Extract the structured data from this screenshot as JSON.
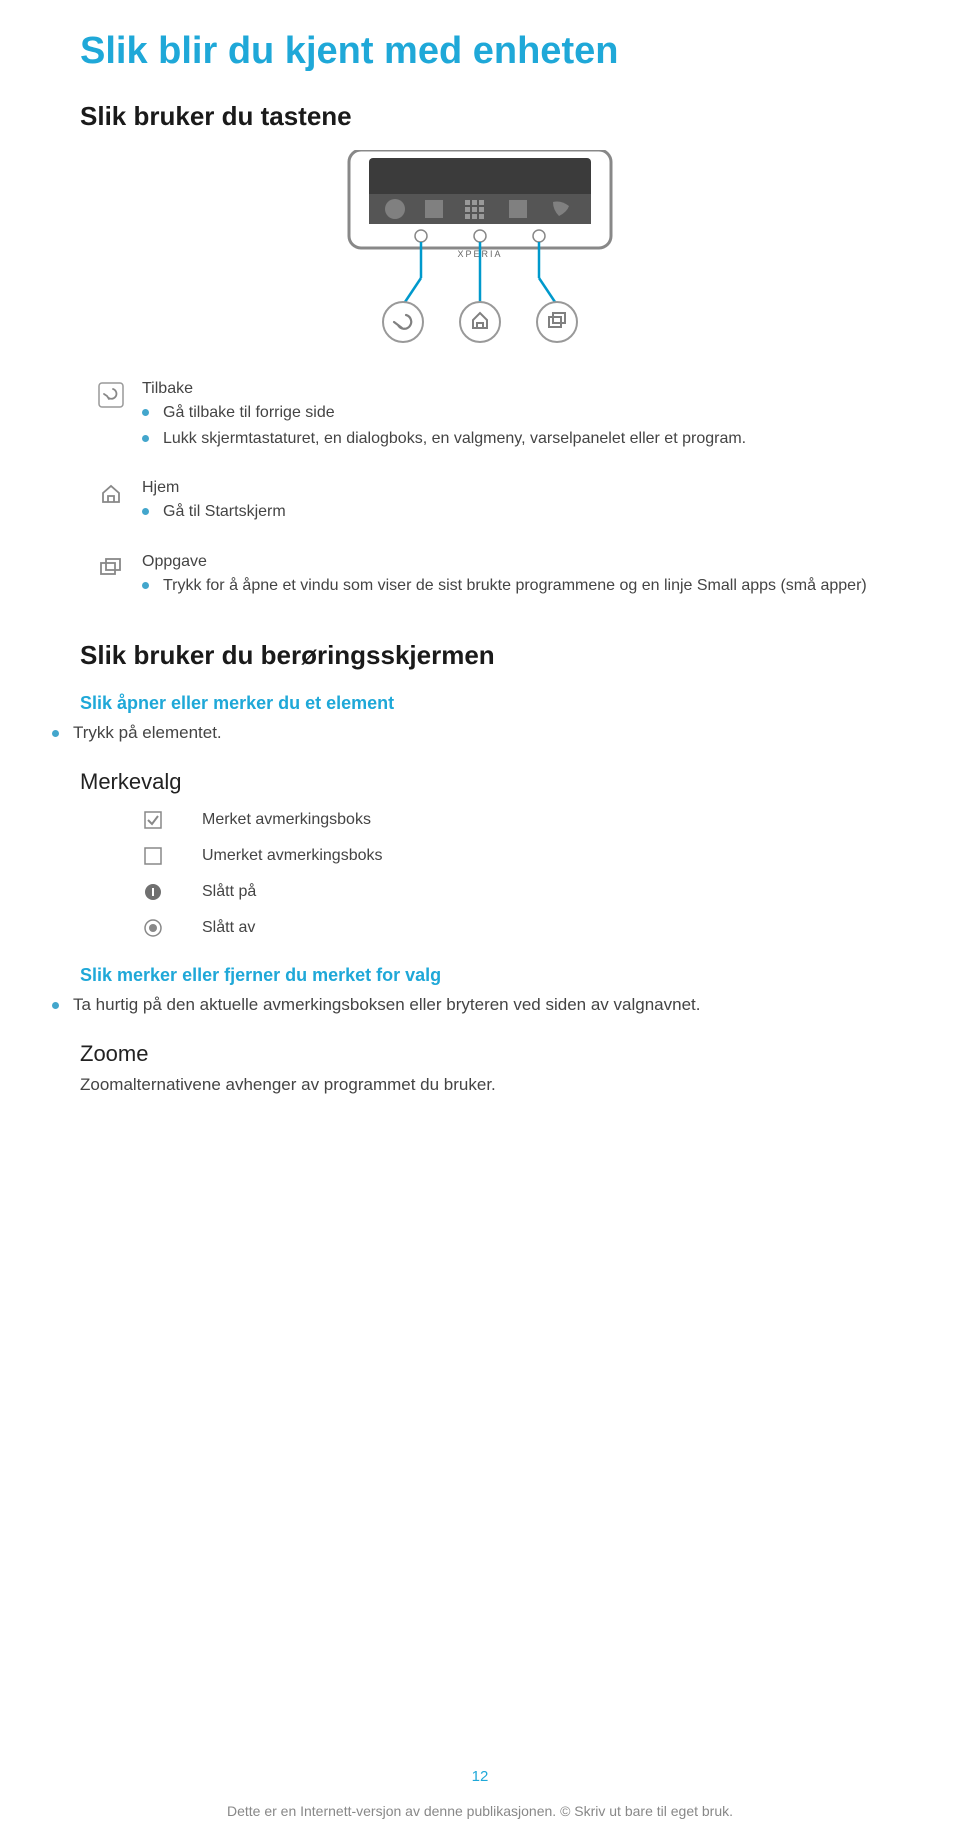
{
  "title": "Slik blir du kjent med enheten",
  "section1_heading": "Slik bruker du tastene",
  "keys": {
    "back": {
      "label": "Tilbake",
      "bullets": [
        "Gå tilbake til forrige side",
        "Lukk skjermtastaturet, en dialogboks, en valgmeny, varselpanelet eller et program."
      ]
    },
    "home": {
      "label": "Hjem",
      "bullets": [
        "Gå til Startskjerm"
      ]
    },
    "task": {
      "label": "Oppgave",
      "bullets": [
        "Trykk for å åpne et vindu som viser de sist brukte programmene og en linje Small apps (små apper)"
      ]
    }
  },
  "section2_heading": "Slik bruker du berøringsskjermen",
  "open_mark": {
    "heading": "Slik åpner eller merker du et element",
    "bullet": "Trykk på elementet."
  },
  "merkevalg": {
    "heading": "Merkevalg",
    "rows": [
      "Merket avmerkingsboks",
      "Umerket avmerkingsboks",
      "Slått på",
      "Slått av"
    ]
  },
  "mark_remove": {
    "heading": "Slik merker eller fjerner du merket for valg",
    "bullet": "Ta hurtig på den aktuelle avmerkingsboksen eller bryteren ved siden av valgnavnet."
  },
  "zoom": {
    "heading": "Zoome",
    "text": "Zoomalternativene avhenger av programmet du bruker."
  },
  "page_number": "12",
  "footer": "Dette er en Internett-versjon av denne publikasjonen. © Skriv ut bare til eget bruk."
}
